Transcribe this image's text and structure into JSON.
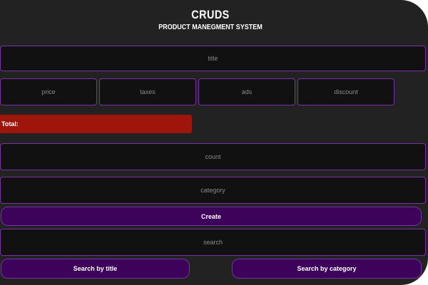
{
  "header": {
    "title": "CRUDS",
    "subtitle": "PRODUCT MANEGMENT SYSTEM"
  },
  "form": {
    "title_placeholder": "title",
    "price_placeholder": "price",
    "taxes_placeholder": "taxes",
    "ads_placeholder": "ads",
    "discount_placeholder": "discount",
    "total_label": "Total:",
    "count_placeholder": "count",
    "category_placeholder": "category",
    "create_label": "Create",
    "search_placeholder": "search",
    "search_title_label": "Search by title",
    "search_category_label": "Search by category"
  },
  "colors": {
    "background": "#222222",
    "input_bg": "#111111",
    "border": "#7a2fa3",
    "total_bg": "#a0150b",
    "button_bg": "#3d0259"
  }
}
